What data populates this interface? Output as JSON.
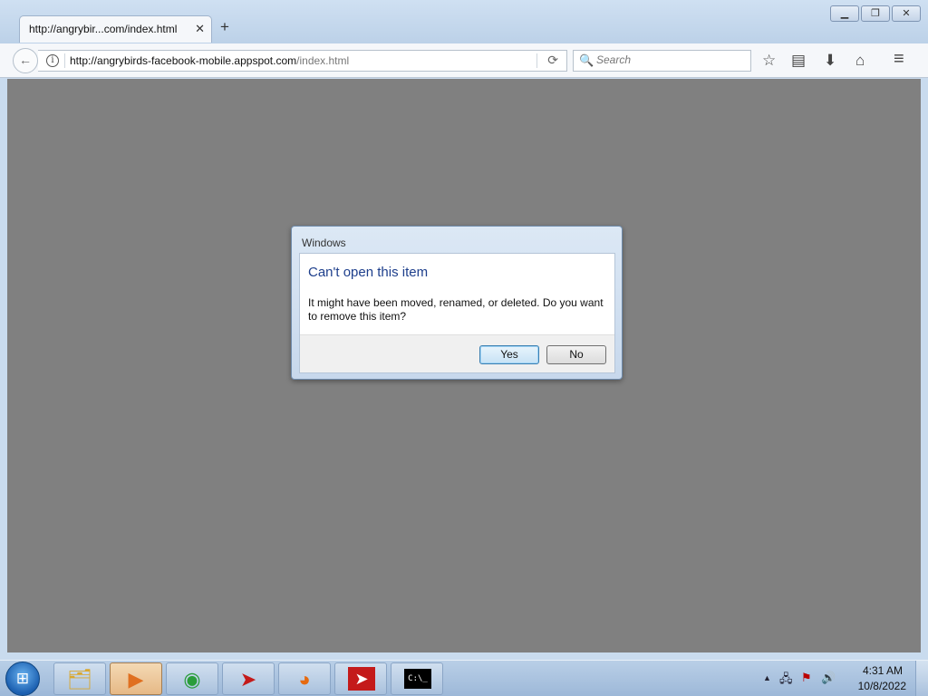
{
  "browser": {
    "tab_title": "http://angrybir...com/index.html",
    "tab_close": "✕",
    "new_tab": "+",
    "window_buttons": {
      "minimize": "▁",
      "restore": "❐",
      "close": "✕"
    },
    "back_icon": "←",
    "info_icon": "i",
    "url_main": "http://angrybirds-facebook-mobile.appspot.com",
    "url_path": "/index.html",
    "reload_icon": "⟳",
    "search_icon": "🔍",
    "search_placeholder": "Search",
    "toolbar_icons": {
      "bookmark": "☆",
      "reader": "▤",
      "download": "⬇",
      "home": "⌂",
      "menu": "≡"
    }
  },
  "dialog": {
    "title": "Windows",
    "heading": "Can't open this item",
    "message": "It might have been moved, renamed, or deleted. Do you want to remove this item?",
    "yes_label": "Yes",
    "no_label": "No"
  },
  "taskbar": {
    "start_icon": "⊞",
    "items": [
      {
        "name": "explorer",
        "glyph": "🗂",
        "color": "#e0b040"
      },
      {
        "name": "media-player",
        "glyph": "▶",
        "color": "#e07020"
      },
      {
        "name": "chrome",
        "glyph": "◉",
        "color": "#2a9d3a"
      },
      {
        "name": "app-red-arrow",
        "glyph": "➤",
        "color": "#c41a1a"
      },
      {
        "name": "firefox",
        "glyph": "◕",
        "color": "#e66a10"
      },
      {
        "name": "app-red-arrow-2",
        "glyph": "➤",
        "color": "#ffffff"
      },
      {
        "name": "cmd",
        "glyph": "C:\\_",
        "color": "#ffffff"
      }
    ],
    "tray": {
      "expand": "▲",
      "network": "🖧",
      "flag": "⚑",
      "volume": "🔊"
    },
    "time": "4:31 AM",
    "date": "10/8/2022"
  }
}
